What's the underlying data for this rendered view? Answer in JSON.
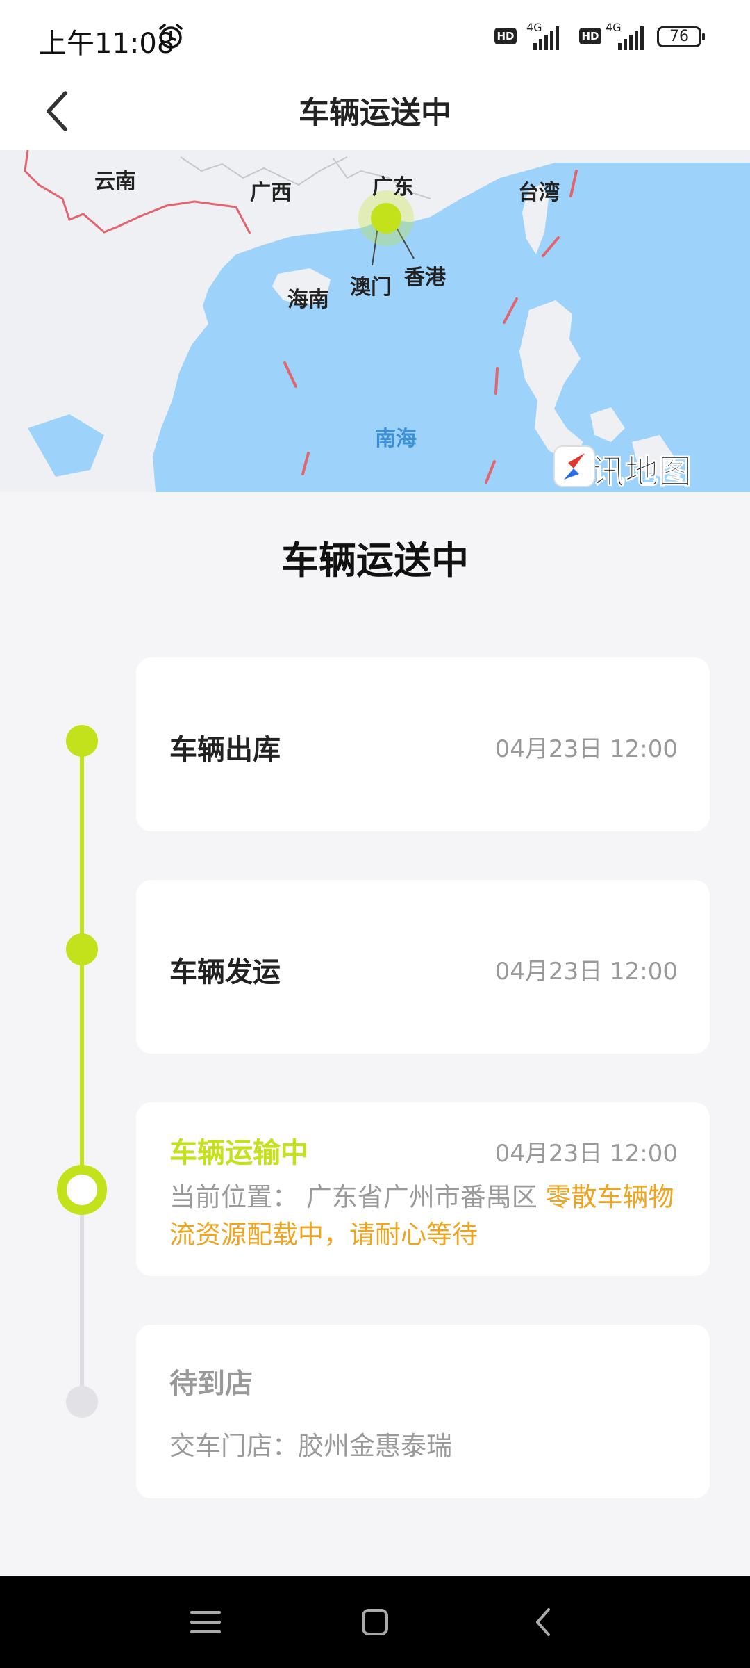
{
  "status_bar": {
    "time": "上午11:08",
    "hd_badge": "HD",
    "network": "4G",
    "battery": "76"
  },
  "header": {
    "title": "车辆运送中"
  },
  "map": {
    "labels": {
      "yunnan": "云南",
      "guangxi": "广西",
      "guangdong": "广东",
      "taiwan": "台湾",
      "hainan": "海南",
      "macau": "澳门",
      "hongkong": "香港",
      "south_sea": "南海"
    },
    "brand": "腾讯地图",
    "colors": {
      "sea": "#9dd3fa",
      "land": "#eef0f3",
      "marker": "#c3e21c"
    }
  },
  "section_title": "车辆运送中",
  "timeline": {
    "steps": [
      {
        "title": "车辆出库",
        "time": "04月23日 12:00"
      },
      {
        "title": "车辆发运",
        "time": "04月23日 12:00"
      },
      {
        "title": "车辆运输中",
        "time": "04月23日 12:00",
        "location_label": "当前位置：",
        "location": "广东省广州市番禺区",
        "note": "零散车辆物流资源配载中，请耐心等待"
      },
      {
        "title": "待到店",
        "store_label": "交车门店：",
        "store": "胶州金惠泰瑞"
      }
    ],
    "colors": {
      "accent": "#c3e21c",
      "note": "#f0a31c",
      "pending": "#dcdce2"
    }
  }
}
